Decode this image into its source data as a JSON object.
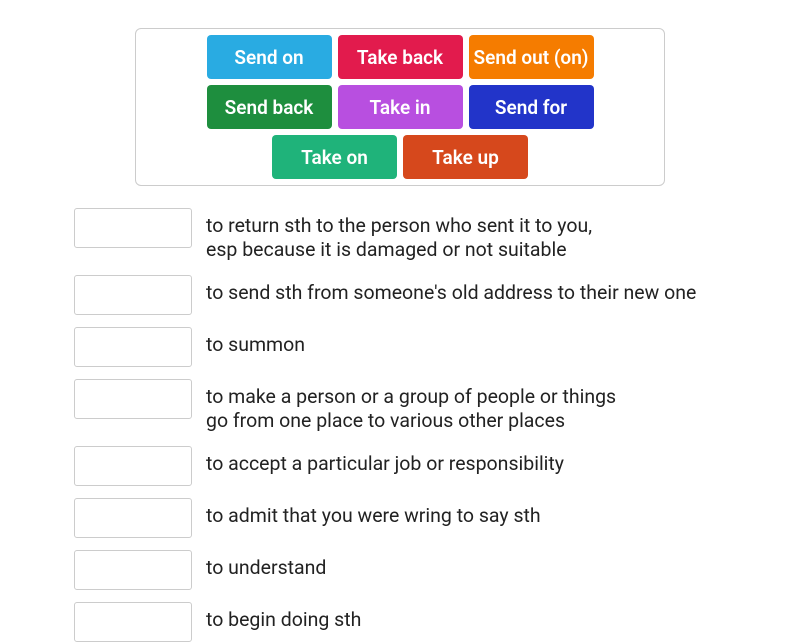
{
  "tiles": [
    {
      "label": "Send on",
      "color": "#29abe2"
    },
    {
      "label": "Take back",
      "color": "#e21b4d"
    },
    {
      "label": "Send out (on)",
      "color": "#f57c00"
    },
    {
      "label": "Send back",
      "color": "#1e8e3e"
    },
    {
      "label": "Take in",
      "color": "#b84fe0"
    },
    {
      "label": "Send for",
      "color": "#2234c9"
    },
    {
      "label": "Take on",
      "color": "#1fb37a"
    },
    {
      "label": "Take up",
      "color": "#d6481c"
    }
  ],
  "definitions": [
    {
      "text": "to return sth to the person who sent it to you,\nesp because it is damaged or not suitable"
    },
    {
      "text": "to send sth from someone's old address to their new one"
    },
    {
      "text": "to summon"
    },
    {
      "text": "to make a person or a group of people or things\ngo from one place to various other places"
    },
    {
      "text": "to accept a particular job or responsibility"
    },
    {
      "text": "to admit that you were wring to say sth"
    },
    {
      "text": "to understand"
    },
    {
      "text": "to begin doing sth"
    }
  ]
}
